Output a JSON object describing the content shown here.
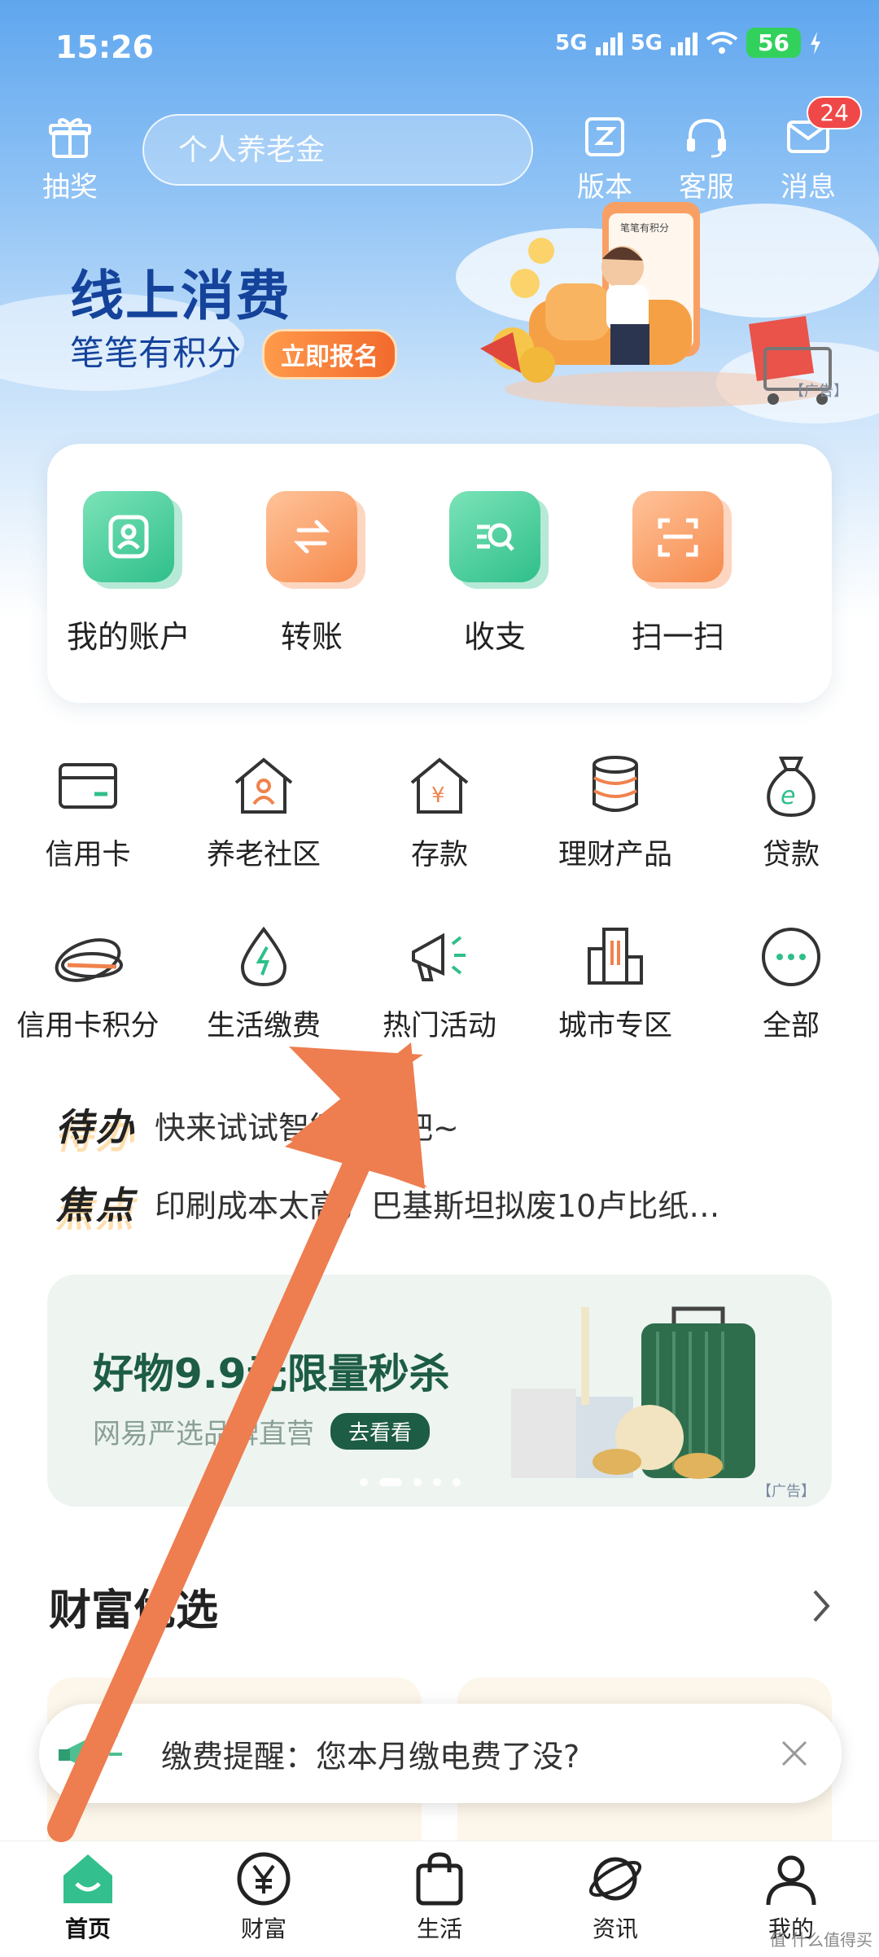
{
  "status_bar": {
    "time": "15:26",
    "network1": "5G",
    "network2": "5G",
    "battery": "56"
  },
  "header": {
    "left_label": "抽奖",
    "search_placeholder": "个人养老金",
    "right_items": [
      {
        "label": "版本",
        "icon": "version-icon"
      },
      {
        "label": "客服",
        "icon": "headset-icon"
      },
      {
        "label": "消息",
        "icon": "mail-icon",
        "badge": "24"
      }
    ]
  },
  "banner": {
    "title": "线上消费",
    "subtitle": "笔笔有积分",
    "button": "立即报名",
    "ad_tag": "【广告】",
    "phone_caption": "笔笔有积分"
  },
  "quick_actions": [
    {
      "label": "我的账户",
      "icon": "user-account-icon",
      "color": "#2fbf8a"
    },
    {
      "label": "转账",
      "icon": "transfer-icon",
      "color": "#f68a4c"
    },
    {
      "label": "收支",
      "icon": "search-bill-icon",
      "color": "#2fbf8a"
    },
    {
      "label": "扫一扫",
      "icon": "scan-icon",
      "color": "#f68a4c"
    }
  ],
  "grid_row1": [
    {
      "label": "信用卡",
      "icon": "credit-card-icon"
    },
    {
      "label": "养老社区",
      "icon": "elderly-community-icon"
    },
    {
      "label": "存款",
      "icon": "deposit-icon"
    },
    {
      "label": "理财产品",
      "icon": "coin-stack-icon"
    },
    {
      "label": "贷款",
      "icon": "loan-bag-icon"
    }
  ],
  "grid_row2": [
    {
      "label": "信用卡积分",
      "icon": "card-points-icon"
    },
    {
      "label": "生活缴费",
      "icon": "utility-drop-icon"
    },
    {
      "label": "热门活动",
      "icon": "megaphone-icon"
    },
    {
      "label": "城市专区",
      "icon": "city-buildings-icon"
    },
    {
      "label": "全部",
      "icon": "more-dots-icon"
    }
  ],
  "notices": [
    {
      "tag": "待办",
      "text": "快来试试智能提醒吧~"
    },
    {
      "tag": "焦点",
      "text": "印刷成本太高，巴基斯坦拟废10卢比纸…"
    }
  ],
  "promo": {
    "title": "好物9.9元限量秒杀",
    "subtitle": "网易严选品牌直营",
    "button": "去看看",
    "ad_tag": "【广告】",
    "slides": 5,
    "active_slide": 2
  },
  "section": {
    "title": "财富优选"
  },
  "toast": {
    "text": "缴费提醒：您本月缴电费了没?"
  },
  "tabbar": [
    {
      "label": "首页",
      "icon": "home-icon",
      "active": true
    },
    {
      "label": "财富",
      "icon": "yen-circle-icon",
      "active": false
    },
    {
      "label": "生活",
      "icon": "shopping-bag-icon",
      "active": false
    },
    {
      "label": "资讯",
      "icon": "planet-icon",
      "active": false
    },
    {
      "label": "我的",
      "icon": "profile-icon",
      "active": false
    }
  ],
  "watermark": "值 什么值得买",
  "colors": {
    "brand_green": "#1d9d6e",
    "annotation_arrow": "#ee7d4f",
    "badge_red": "#f04848"
  }
}
